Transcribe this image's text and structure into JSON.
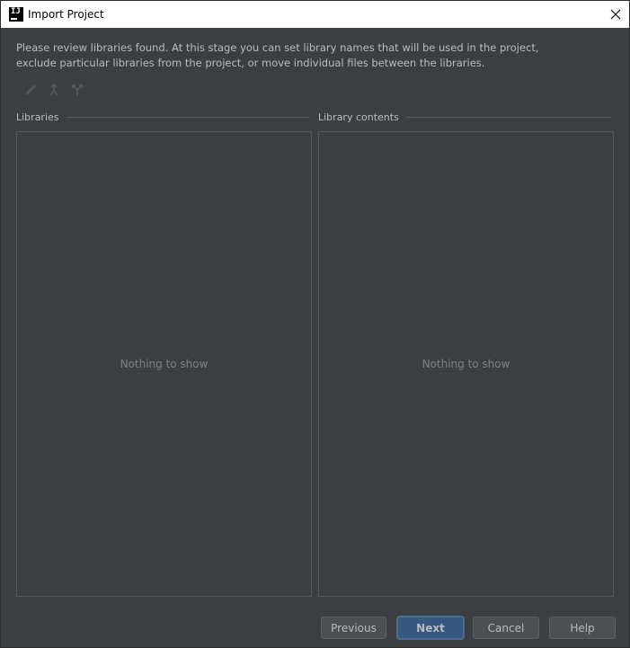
{
  "window": {
    "title": "Import Project",
    "app_icon_text": "IJ"
  },
  "description": {
    "line1": "Please review libraries found. At this stage you can set library names that will be used in the project,",
    "line2": "exclude particular libraries from the project, or move individual files between the libraries."
  },
  "toolbar": {
    "items": [
      {
        "icon": "pencil-icon"
      },
      {
        "icon": "merge-icon"
      },
      {
        "icon": "split-icon"
      }
    ]
  },
  "libraries": {
    "header": "Libraries",
    "empty_text": "Nothing to show"
  },
  "library_contents": {
    "header": "Library contents",
    "empty_text": "Nothing to show"
  },
  "buttons": {
    "previous": "Previous",
    "next": "Next",
    "cancel": "Cancel",
    "help": "Help"
  },
  "colors": {
    "background": "#3c3f41",
    "text": "#bbbbbb",
    "muted_text": "#808080",
    "primary_button": "#365880",
    "titlebar": "#ffffff"
  }
}
